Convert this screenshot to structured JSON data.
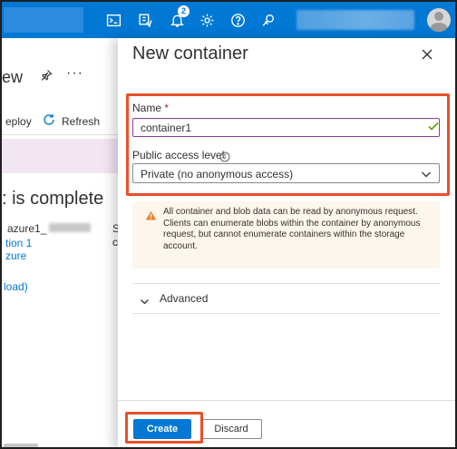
{
  "colors": {
    "accent": "#0078d4",
    "highlight": "#e8502a",
    "success": "#57a300",
    "warning_bg": "#fdf6ec"
  },
  "topbar": {
    "icons": [
      "cloud-shell-icon",
      "directory-filter-icon",
      "notifications-icon",
      "settings-icon",
      "help-icon",
      "feedback-icon"
    ],
    "notifications_count": "2"
  },
  "background_page": {
    "title_fragment": "ew",
    "redeploy_label": "eploy",
    "refresh_label": "Refresh",
    "status_heading": ": is complete",
    "resource_name": "azure1_",
    "col_fragment": "S",
    "col_fragment2": "c",
    "link1": "tion 1",
    "link2": "zure",
    "link3": "load)"
  },
  "panel": {
    "title": "New container",
    "name_label": "Name",
    "required_mark": "*",
    "name_value": "container1",
    "access_label": "Public access level",
    "access_value": "Private (no anonymous access)",
    "warning_text": "All container and blob data can be read by anonymous request. Clients can enumerate blobs within the container by anonymous request, but cannot enumerate containers within the storage account.",
    "advanced_label": "Advanced",
    "create_label": "Create",
    "discard_label": "Discard"
  }
}
